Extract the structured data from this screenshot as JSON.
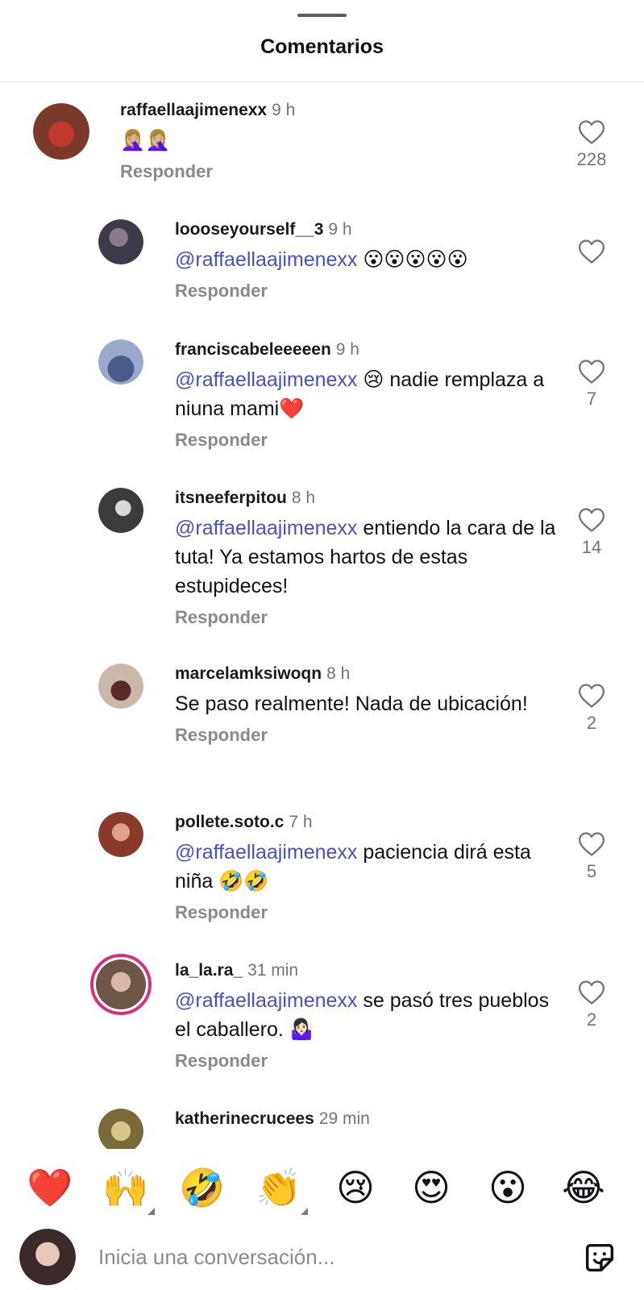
{
  "sheet": {
    "title": "Comentarios"
  },
  "comments": [
    {
      "username": "raffaellaajimenexx",
      "time": "9 h",
      "mention": "",
      "text": "🤦🏼‍♀️🤦🏼‍♀️",
      "reply_label": "Responder",
      "likes": "228",
      "avatar_color": "#7a3a2a"
    },
    {
      "username": "loooseyourself__3",
      "time": "9 h",
      "mention": "@raffaellaajimenexx",
      "text": " 😮😮😮😮😮",
      "reply_label": "Responder",
      "likes": "",
      "avatar_color": "#3e3a4a"
    },
    {
      "username": "franciscabeleeeeen",
      "time": "9 h",
      "mention": "@raffaellaajimenexx",
      "text": " 😢 nadie remplaza a niuna mami❤️",
      "reply_label": "Responder",
      "likes": "7",
      "avatar_color": "#6b7aa8"
    },
    {
      "username": "itsneeferpitou",
      "time": "8 h",
      "mention": "@raffaellaajimenexx",
      "text": " entiendo la cara de la tuta! Ya estamos hartos de estas estupideces!",
      "reply_label": "Responder",
      "likes": "14",
      "avatar_color": "#3b3b3b"
    },
    {
      "username": "marcelamksiwoqn",
      "time": "8 h",
      "mention": "",
      "text": "Se paso realmente!  Nada de ubicación!",
      "reply_label": "Responder",
      "likes": "2",
      "avatar_color": "#8a5a4a"
    },
    {
      "username": "pollete.soto.c",
      "time": "7 h",
      "mention": "@raffaellaajimenexx",
      "text": "  paciencia dirá esta niña 🤣🤣",
      "reply_label": "Responder",
      "likes": "5",
      "avatar_color": "#b5644a"
    },
    {
      "username": "la_la.ra_",
      "time": "31 min",
      "mention": "@raffaellaajimenexx",
      "text": " se pasó tres pueblos el caballero. 🤷🏻‍♀️",
      "reply_label": "Responder",
      "likes": "2",
      "avatar_color": "#6d5548"
    },
    {
      "username": "katherinecrucees",
      "time": "29 min",
      "mention": "",
      "text": "",
      "reply_label": "",
      "likes": "",
      "avatar_color": "#7a6a3a"
    }
  ],
  "reactions": [
    {
      "emoji": "❤️",
      "has_variants": false
    },
    {
      "emoji": "🙌",
      "has_variants": true
    },
    {
      "emoji": "🤣",
      "has_variants": false
    },
    {
      "emoji": "👏",
      "has_variants": true
    },
    {
      "emoji": "😢",
      "has_variants": false
    },
    {
      "emoji": "😍",
      "has_variants": false
    },
    {
      "emoji": "😮",
      "has_variants": false
    },
    {
      "emoji": "😂",
      "has_variants": false
    }
  ],
  "composer": {
    "placeholder": "Inicia una conversación..."
  },
  "icons": {
    "like": "heart-outline-icon",
    "sticker": "sticker-icon"
  }
}
